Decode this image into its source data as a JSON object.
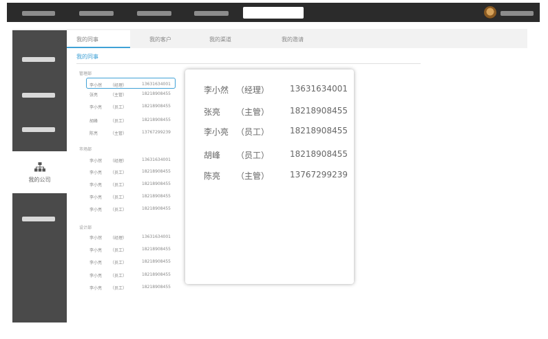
{
  "sidebar": {
    "active_label": "我的公司"
  },
  "tabs": [
    {
      "label": "我的同事"
    },
    {
      "label": "我的客户"
    },
    {
      "label": "我的渠道"
    },
    {
      "label": "我的邀请"
    }
  ],
  "subtab": "我的同事",
  "departments": [
    {
      "name": "管理部",
      "members": [
        {
          "name": "李小然",
          "role": "（经理）",
          "phone": "13631634001"
        },
        {
          "name": "张亮",
          "role": "（主管）",
          "phone": "18218908455"
        },
        {
          "name": "李小亮",
          "role": "（员工）",
          "phone": "18218908455"
        },
        {
          "name": "胡峰",
          "role": "（员工）",
          "phone": "18218908455"
        },
        {
          "name": "陈亮",
          "role": "（主管）",
          "phone": "13767299239"
        }
      ]
    },
    {
      "name": "市场部",
      "members": [
        {
          "name": "李小然",
          "role": "（经理）",
          "phone": "13631634001"
        },
        {
          "name": "李小亮",
          "role": "（员工）",
          "phone": "18218908455"
        },
        {
          "name": "李小亮",
          "role": "（员工）",
          "phone": "18218908455"
        },
        {
          "name": "李小亮",
          "role": "（员工）",
          "phone": "18218908455"
        },
        {
          "name": "李小亮",
          "role": "（员工）",
          "phone": "18218908455"
        }
      ]
    },
    {
      "name": "设计部",
      "members": [
        {
          "name": "李小然",
          "role": "（经理）",
          "phone": "13631634001"
        },
        {
          "name": "李小亮",
          "role": "（员工）",
          "phone": "18218908455"
        },
        {
          "name": "李小亮",
          "role": "（员工）",
          "phone": "18218908455"
        },
        {
          "name": "李小亮",
          "role": "（员工）",
          "phone": "18218908455"
        },
        {
          "name": "李小亮",
          "role": "（员工）",
          "phone": "18218908455"
        }
      ]
    }
  ],
  "popup": {
    "members": [
      {
        "name": "李小然",
        "role": "（经理）",
        "phone": "13631634001"
      },
      {
        "name": "张亮",
        "role": "（主管）",
        "phone": "18218908455"
      },
      {
        "name": "李小亮",
        "role": "（员工）",
        "phone": "18218908455"
      },
      {
        "name": "胡峰",
        "role": "（员工）",
        "phone": "18218908455"
      },
      {
        "name": "陈亮",
        "role": "（主管）",
        "phone": "13767299239"
      }
    ]
  },
  "colors": {
    "accent": "#3fa1d6",
    "topbar": "#2b2b2b",
    "sidebar": "#4a4a4a"
  }
}
